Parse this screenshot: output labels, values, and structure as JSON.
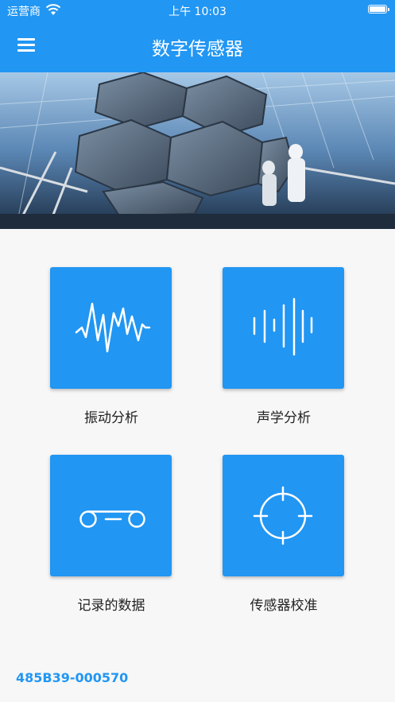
{
  "status_bar": {
    "carrier": "运营商",
    "time": "上午 10:03"
  },
  "app_bar": {
    "title": "数字传感器",
    "menu_icon": "menu-icon"
  },
  "tiles": [
    {
      "label": "振动分析",
      "icon": "waveform-icon"
    },
    {
      "label": "声学分析",
      "icon": "sound-bars-icon"
    },
    {
      "label": "记录的数据",
      "icon": "tape-recording-icon"
    },
    {
      "label": "传感器校准",
      "icon": "crosshair-icon"
    }
  ],
  "device_id": "485B39-000570",
  "colors": {
    "primary": "#2196f3",
    "background": "#f7f7f7"
  }
}
